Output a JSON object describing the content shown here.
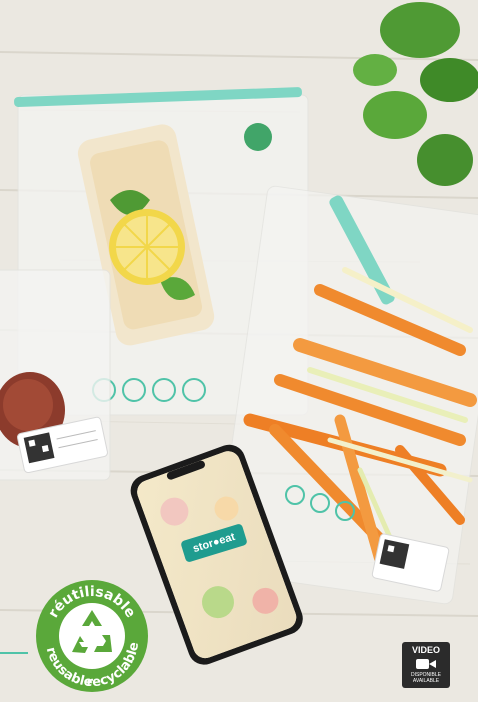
{
  "badge": {
    "top_text": "réutilisable",
    "left_text": "reusable",
    "bottom_text": "recyclable",
    "color": "#5aa83a"
  },
  "phone": {
    "logo_text": "stor●eat"
  },
  "video_badge": {
    "title": "VIDEO",
    "line1": "DISPONIBLE",
    "line2": "AVAILABLE",
    "icon": "video-camera-icon"
  },
  "colors": {
    "wood": "#ece9e2",
    "zip_teal": "#7fd6c4",
    "carrot": "#f08a2e",
    "basil": "#4f9a34",
    "lemon": "#f2d74a"
  }
}
